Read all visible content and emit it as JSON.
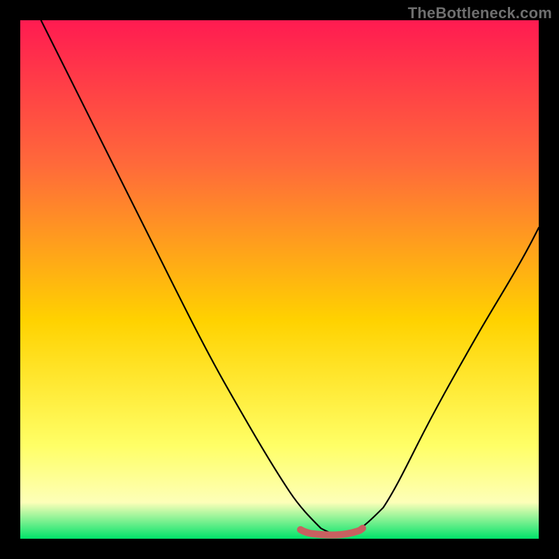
{
  "watermark": "TheBottleneck.com",
  "colors": {
    "background": "#000000",
    "gradient_top": "#ff1b51",
    "gradient_upper_mid": "#ff6a3a",
    "gradient_mid": "#ffd200",
    "gradient_lower_mid": "#ffff66",
    "gradient_near_bottom": "#fdffb8",
    "gradient_bottom": "#00e36a",
    "curve": "#000000",
    "valley_marker": "#c86060"
  },
  "chart_data": {
    "type": "line",
    "title": "",
    "xlabel": "",
    "ylabel": "",
    "xlim": [
      0,
      100
    ],
    "ylim": [
      0,
      100
    ],
    "series": [
      {
        "name": "bottleneck-curve",
        "x": [
          4,
          8,
          12,
          16,
          20,
          24,
          28,
          32,
          36,
          40,
          44,
          48,
          52,
          55,
          58,
          61,
          64,
          68,
          72,
          76,
          80,
          84,
          88,
          92,
          96,
          100
        ],
        "y": [
          100,
          92,
          84,
          76,
          68,
          60,
          52,
          44,
          36,
          29,
          22,
          15,
          9,
          4,
          1.5,
          0.8,
          1.0,
          4,
          9,
          15,
          22,
          29,
          36,
          44,
          52,
          60
        ]
      }
    ],
    "annotations": [
      {
        "name": "valley-flat-marker",
        "x_range": [
          54,
          66
        ],
        "y": 0.9,
        "color": "#c86060"
      }
    ],
    "grid": false,
    "legend": false
  }
}
